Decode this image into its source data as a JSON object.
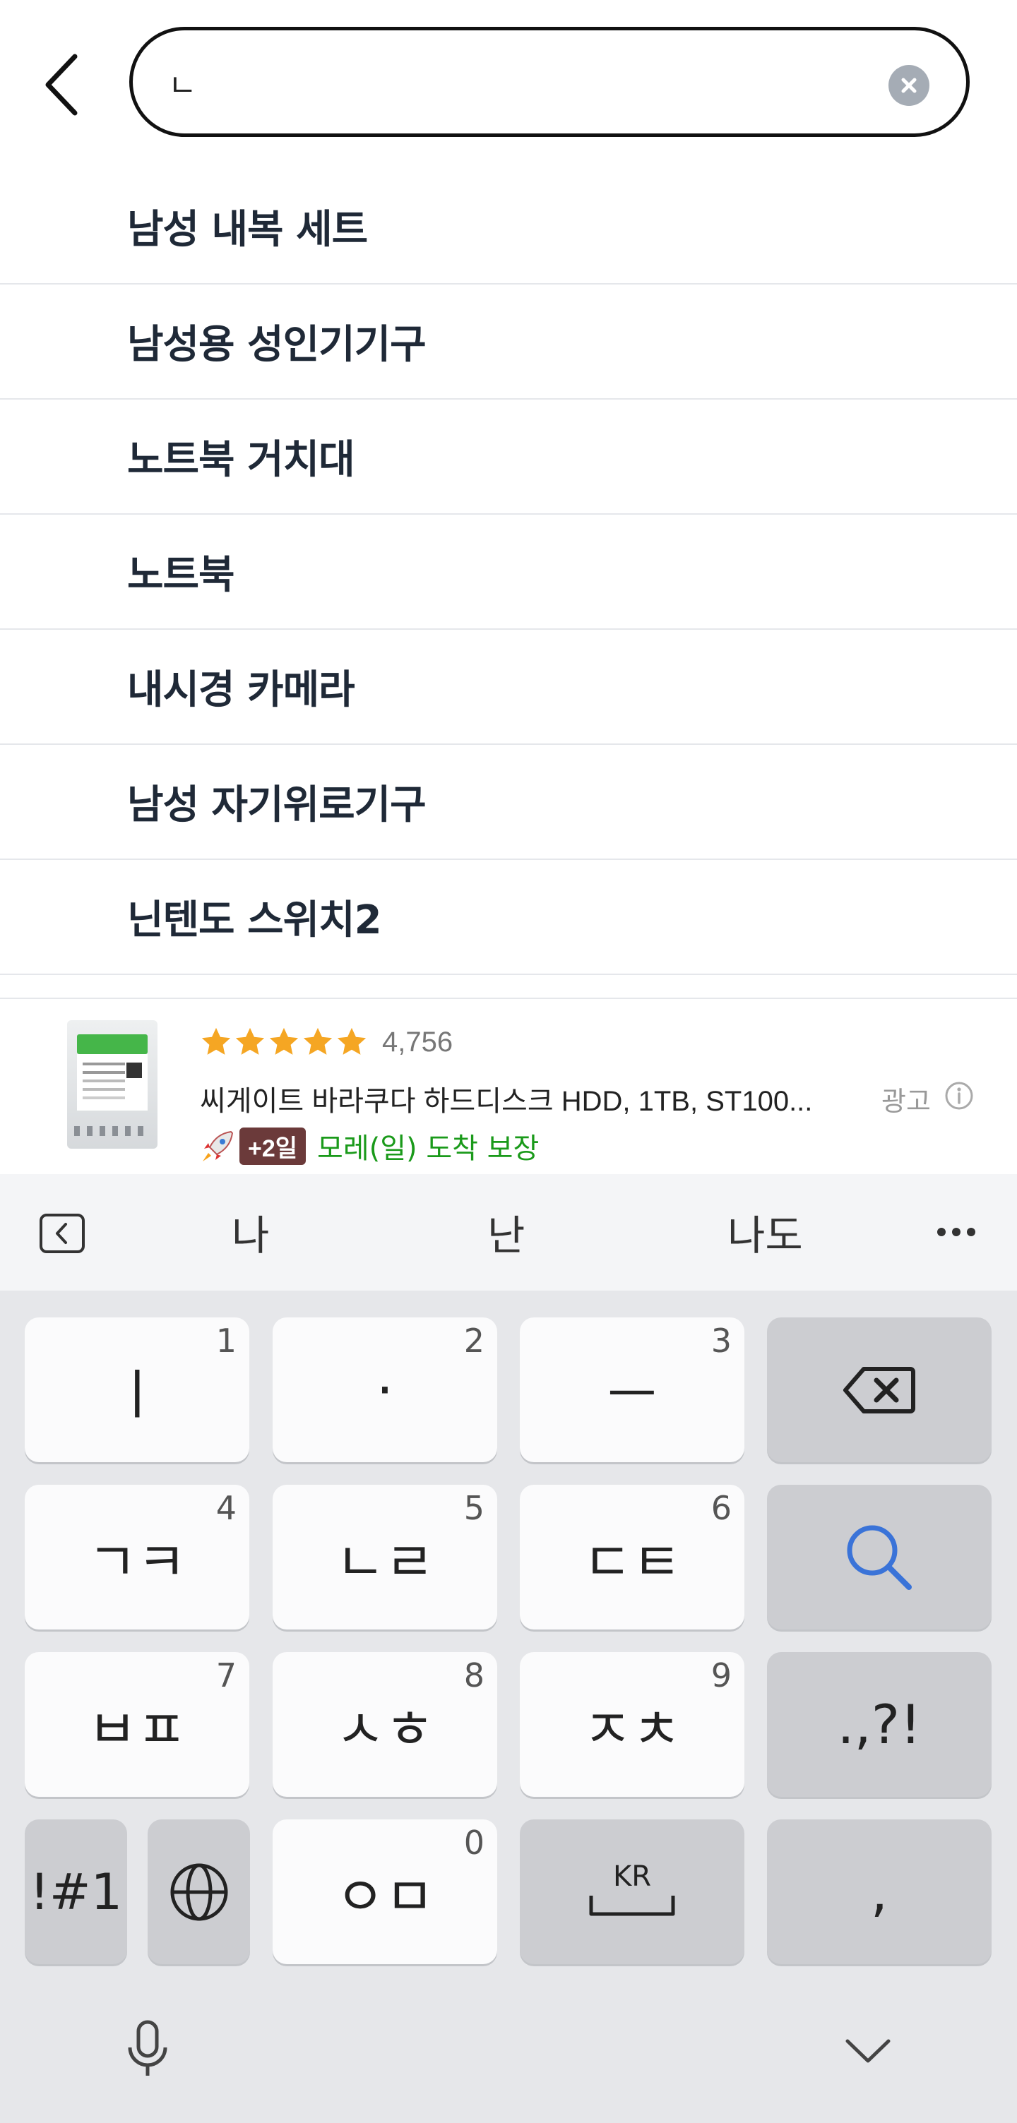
{
  "search": {
    "value": "ㄴ",
    "placeholder": ""
  },
  "suggestions": [
    {
      "label": "남성 내복 세트"
    },
    {
      "label": "남성용 성인기기구"
    },
    {
      "label": "노트북 거치대"
    },
    {
      "label": "노트북"
    },
    {
      "label": "내시경 카메라"
    },
    {
      "label": "남성 자기위로기구"
    },
    {
      "label": "닌텐도 스위치2"
    }
  ],
  "ad": {
    "rating_stars": 5,
    "rating_count": "4,756",
    "title": "씨게이트 바라쿠다 하드디스크 HDD, 1TB, ST100...",
    "badge": "광고",
    "day_badge": "+2일",
    "delivery": "모레(일) 도착 보장",
    "colors": {
      "star": "#f5a623",
      "delivery": "#1a9a1a",
      "day_badge_bg": "#6b3a3a"
    }
  },
  "keyboard": {
    "suggestions": [
      "나",
      "난",
      "나도"
    ],
    "rows": [
      [
        {
          "label": "ㅣ",
          "num": "1"
        },
        {
          "label": "·",
          "num": "2"
        },
        {
          "label": "ㅡ",
          "num": "3"
        },
        {
          "label": "",
          "icon": "backspace-icon"
        }
      ],
      [
        {
          "label": "ㄱㅋ",
          "num": "4"
        },
        {
          "label": "ㄴㄹ",
          "num": "5"
        },
        {
          "label": "ㄷㅌ",
          "num": "6"
        },
        {
          "label": "",
          "icon": "search-icon"
        }
      ],
      [
        {
          "label": "ㅂㅍ",
          "num": "7"
        },
        {
          "label": "ㅅㅎ",
          "num": "8"
        },
        {
          "label": "ㅈㅊ",
          "num": "9"
        },
        {
          "label": ".,?!"
        }
      ],
      [
        {
          "label": "!#1"
        },
        {
          "label": "",
          "icon": "globe-icon"
        },
        {
          "label": "ㅇㅁ",
          "num": "0"
        },
        {
          "label": "KR",
          "icon": "space-icon"
        },
        {
          "label": ","
        }
      ]
    ]
  }
}
